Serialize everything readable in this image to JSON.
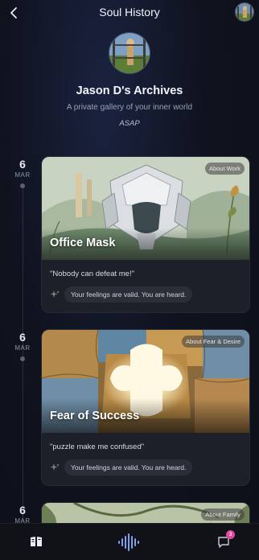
{
  "header": {
    "title": "Soul History",
    "back_icon": "chevron-left-icon",
    "avatar_icon": "user-avatar"
  },
  "profile": {
    "name": "Jason D's Archives",
    "subtitle": "A private gallery of your inner world",
    "tag": "ASAP"
  },
  "entries": [
    {
      "day": "6",
      "month": "MAR",
      "category": "About Work",
      "title": "Office Mask",
      "quote": "\"Nobody can defeat me!\"",
      "response": "Your feelings are valid. You are heard."
    },
    {
      "day": "6",
      "month": "MAR",
      "category": "About Fear & Desire",
      "title": "Fear of Success",
      "quote": "\"puzzle make me confused\"",
      "response": "Your feelings are valid. You are heard."
    },
    {
      "day": "6",
      "month": "MAR",
      "category": "About Family"
    }
  ],
  "bottom_nav": {
    "items": [
      "book-icon",
      "voice-wave-icon",
      "chat-icon"
    ],
    "chat_badge": "3"
  },
  "colors": {
    "accent_badge": "#e0489a",
    "background": "#0d0f18",
    "card": "#1d2028"
  }
}
